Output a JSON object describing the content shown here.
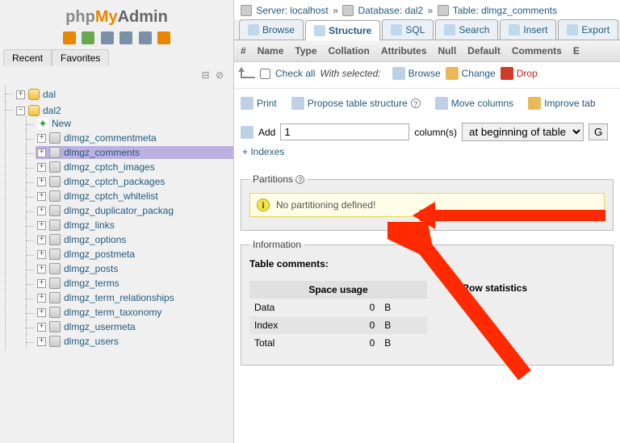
{
  "logo": {
    "p1": "php",
    "p2": "My",
    "p3": "Admin"
  },
  "sidebarTabs": {
    "recent": "Recent",
    "favorites": "Favorites"
  },
  "tree": {
    "db1": "dal",
    "db2": "dal2",
    "new": "New",
    "tables": [
      "dlmgz_commentmeta",
      "dlmgz_comments",
      "dlmgz_cptch_images",
      "dlmgz_cptch_packages",
      "dlmgz_cptch_whitelist",
      "dlmgz_duplicator_packag",
      "dlmgz_links",
      "dlmgz_options",
      "dlmgz_postmeta",
      "dlmgz_posts",
      "dlmgz_terms",
      "dlmgz_term_relationships",
      "dlmgz_term_taxonomy",
      "dlmgz_usermeta",
      "dlmgz_users"
    ],
    "selectedIndex": 1
  },
  "breadcrumb": {
    "server_lbl": "Server:",
    "server_val": "localhost",
    "db_lbl": "Database:",
    "db_val": "dal2",
    "tbl_lbl": "Table:",
    "tbl_val": "dlmgz_comments",
    "sep": "»"
  },
  "tabs": {
    "browse": "Browse",
    "structure": "Structure",
    "sql": "SQL",
    "search": "Search",
    "insert": "Insert",
    "export": "Export"
  },
  "columns": {
    "num": "#",
    "name": "Name",
    "type": "Type",
    "collation": "Collation",
    "attributes": "Attributes",
    "null": "Null",
    "default": "Default",
    "comments": "Comments",
    "extra": "E"
  },
  "rowActions": {
    "checkAll": "Check all",
    "withSelected": "With selected:",
    "browse": "Browse",
    "change": "Change",
    "drop": "Drop"
  },
  "actions": {
    "print": "Print",
    "propose": "Propose table structure",
    "move": "Move columns",
    "improve": "Improve tab"
  },
  "addRow": {
    "addLbl": "Add",
    "value": "1",
    "colLbl": "column(s)",
    "position": "at beginning of table",
    "go": "G"
  },
  "indexes": "+ Indexes",
  "partitions": {
    "legend": "Partitions",
    "notice": "No partitioning defined!"
  },
  "info": {
    "legend": "Information",
    "comments": "Table comments:",
    "spaceHeader": "Space usage",
    "rowHeader": "Row statistics",
    "rows": [
      {
        "label": "Data",
        "val": "0",
        "unit": "B"
      },
      {
        "label": "Index",
        "val": "0",
        "unit": "B"
      },
      {
        "label": "Total",
        "val": "0",
        "unit": "B"
      }
    ]
  }
}
